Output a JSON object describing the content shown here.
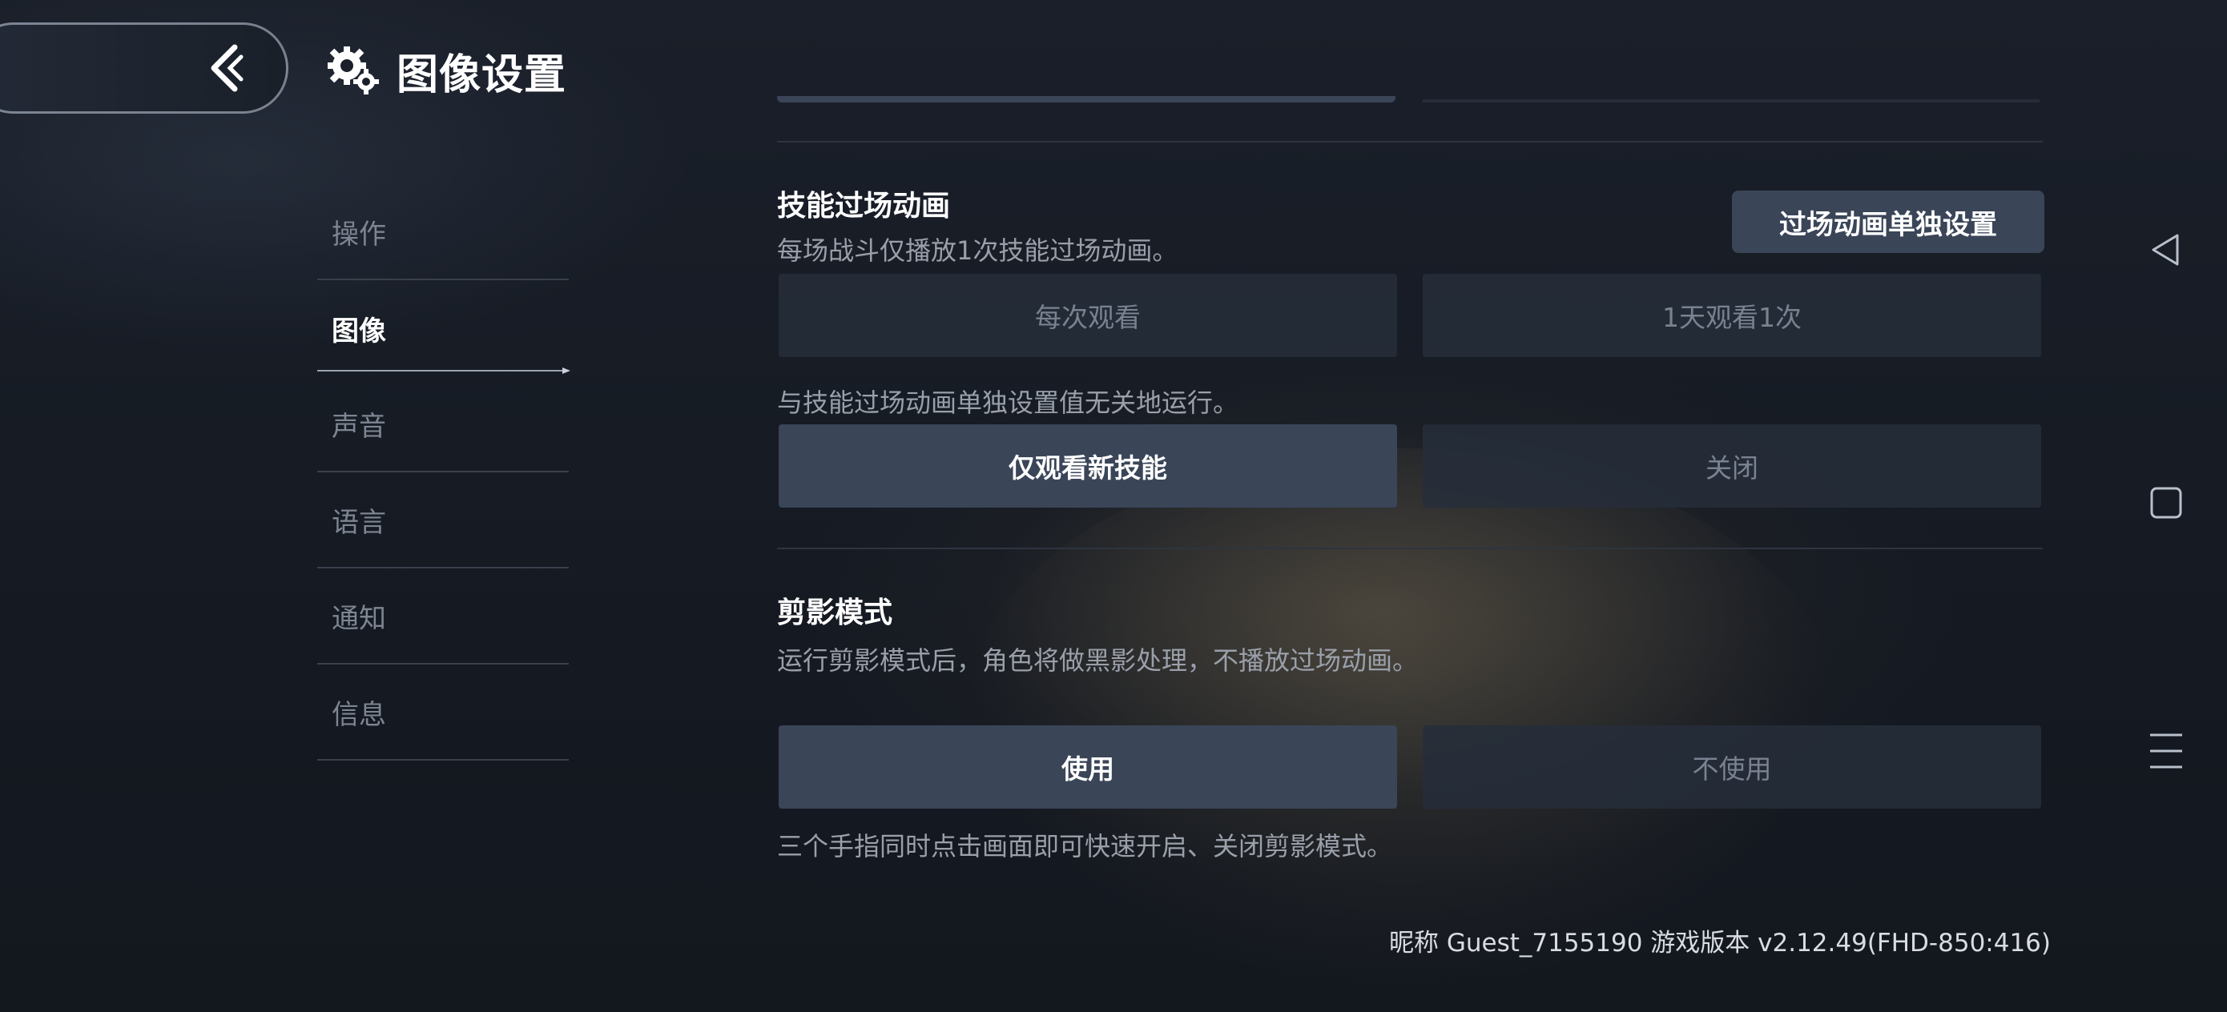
{
  "header": {
    "title": "图像设置",
    "back_icon": "chevron-left-icon",
    "settings_icon": "gear-icon"
  },
  "sidebar": {
    "items": [
      {
        "label": "操作",
        "active": false
      },
      {
        "label": "图像",
        "active": true
      },
      {
        "label": "声音",
        "active": false
      },
      {
        "label": "语言",
        "active": false
      },
      {
        "label": "通知",
        "active": false
      },
      {
        "label": "信息",
        "active": false
      }
    ]
  },
  "skill_cutscene": {
    "title": "技能过场动画",
    "description": "每场战斗仅播放1次技能过场动画。",
    "separate_settings_label": "过场动画单独设置",
    "options": [
      {
        "label": "每次观看",
        "selected": false
      },
      {
        "label": "1天观看1次",
        "selected": false
      }
    ],
    "note": "与技能过场动画单独设置值无关地运行。",
    "options2": [
      {
        "label": "仅观看新技能",
        "selected": true
      },
      {
        "label": "关闭",
        "selected": false
      }
    ]
  },
  "silhouette_mode": {
    "title": "剪影模式",
    "description": "运行剪影模式后，角色将做黑影处理，不播放过场动画。",
    "options": [
      {
        "label": "使用",
        "selected": true
      },
      {
        "label": "不使用",
        "selected": false
      }
    ],
    "hint": "三个手指同时点击画面即可快速开启、关闭剪影模式。"
  },
  "footer": {
    "version_text": "昵称 Guest_7155190 游戏版本 v2.12.49(FHD-850:416)"
  },
  "system_nav": {
    "back_icon": "triangle-back-icon",
    "home_icon": "square-home-icon",
    "menu_icon": "menu-icon"
  },
  "colors": {
    "selected_button": "#3a4558",
    "unselected_button": "#262d3a",
    "background": "#161b24"
  }
}
